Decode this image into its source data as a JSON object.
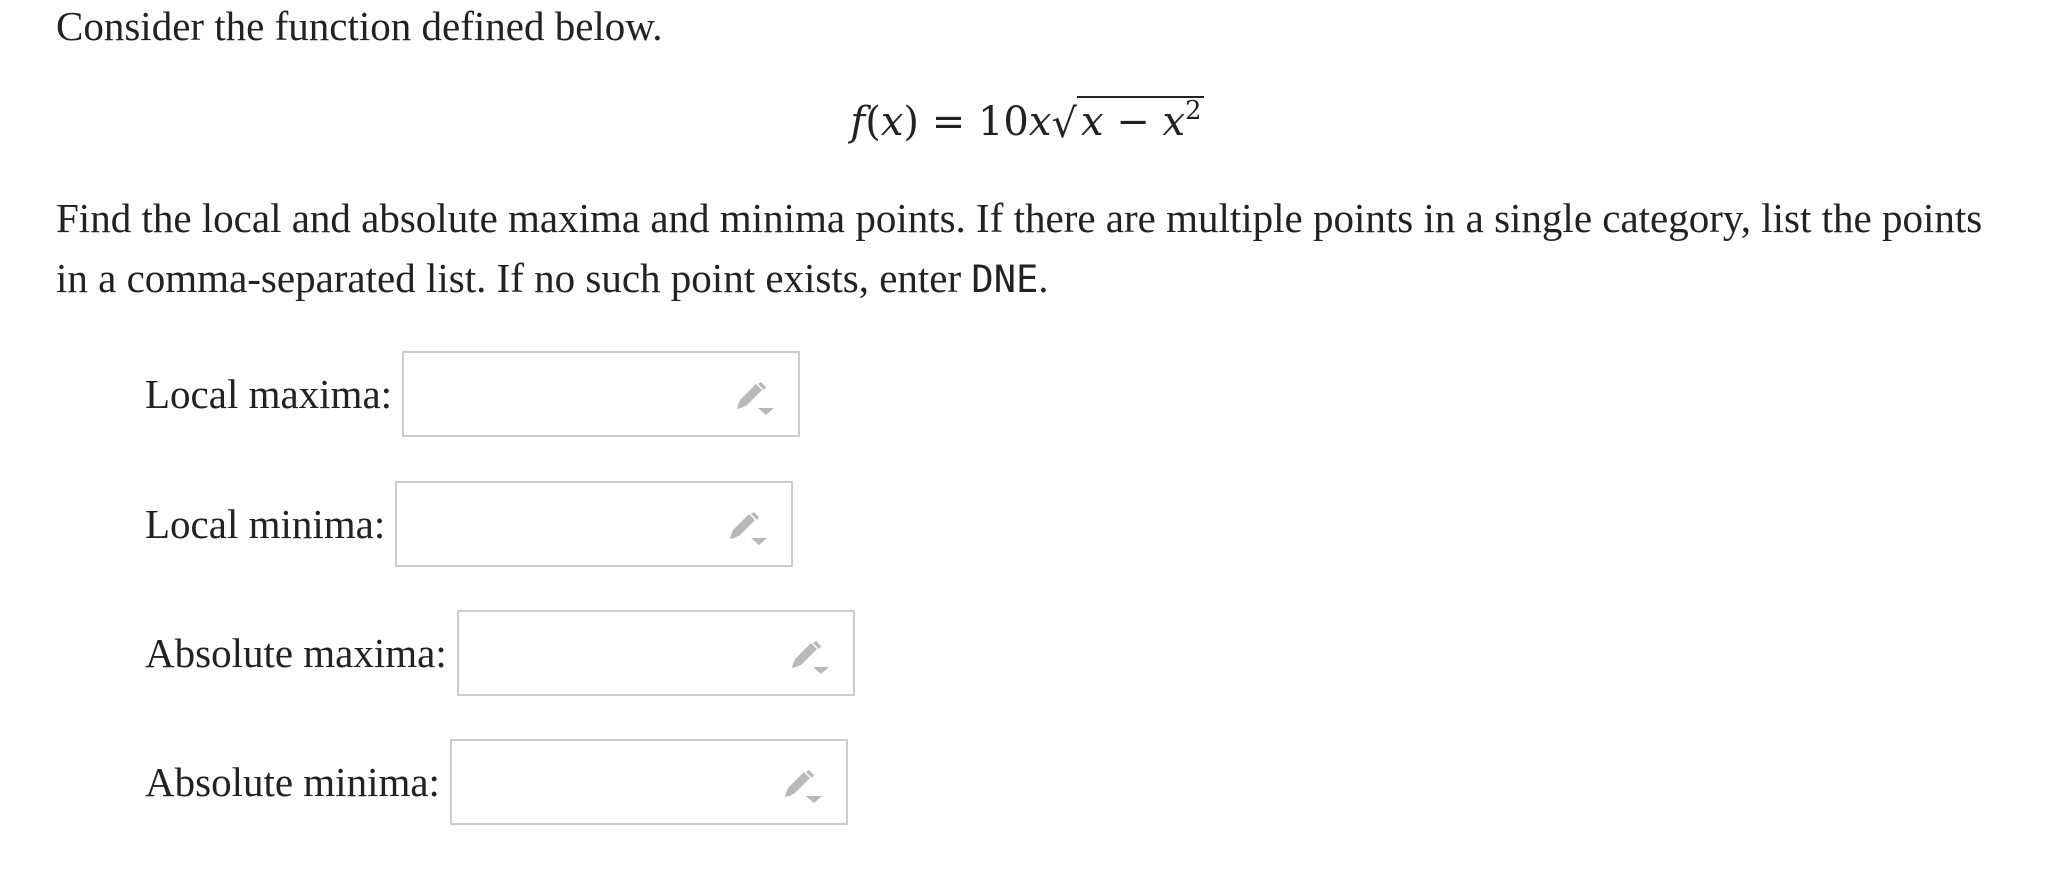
{
  "question": {
    "intro": "Consider the function defined below.",
    "formula": {
      "lhs": "f(x)",
      "equals": "=",
      "coefficient": "10x",
      "radicand": "x − x",
      "exponent": "2"
    },
    "instructions_part1": "Find the local and absolute maxima and minima points. If there are multiple points in a single category, list the points in a comma-separated list. If no such point exists, enter ",
    "dne_code": "DNE",
    "instructions_part2": "."
  },
  "answers": {
    "local_maxima": {
      "label": "Local maxima:",
      "value": ""
    },
    "local_minima": {
      "label": "Local minima:",
      "value": ""
    },
    "absolute_maxima": {
      "label": "Absolute maxima:",
      "value": ""
    },
    "absolute_minima": {
      "label": "Absolute minima:",
      "value": ""
    }
  },
  "icons": {
    "answer_box_icon": "pencil-dropdown-icon"
  },
  "colors": {
    "text": "#222222",
    "box_border": "#cccccc",
    "icon": "#b8b8b8"
  }
}
